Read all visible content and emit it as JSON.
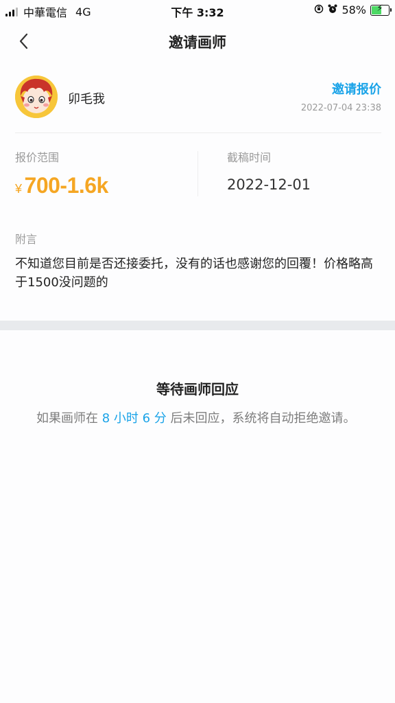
{
  "status_bar": {
    "carrier": "中華電信",
    "network": "4G",
    "time": "下午 3:32",
    "battery": "58%",
    "battery_level": 0.58
  },
  "navbar": {
    "back_icon": "chevron-left-icon",
    "title": "邀请画师"
  },
  "user": {
    "name": "卯毛我",
    "action_label": "邀请报价",
    "timestamp": "2022-07-04 23:38"
  },
  "quote": {
    "price_label": "报价范围",
    "currency": "¥",
    "price": "700-1.6k",
    "deadline_label": "截稿时间",
    "deadline": "2022-12-01"
  },
  "note": {
    "label": "附言",
    "text": "不知道您目前是否还接委托，没有的话也感谢您的回覆！价格略高于1500没问题的"
  },
  "waiting": {
    "title": "等待画师回应",
    "text_before": "如果画师在 ",
    "countdown": "8 小时 6 分",
    "text_after": " 后未回应，系统将自动拒绝邀请。"
  },
  "colors": {
    "accent": "#1aa3e8",
    "price": "#f5a623",
    "separator": "#e8eaed"
  }
}
